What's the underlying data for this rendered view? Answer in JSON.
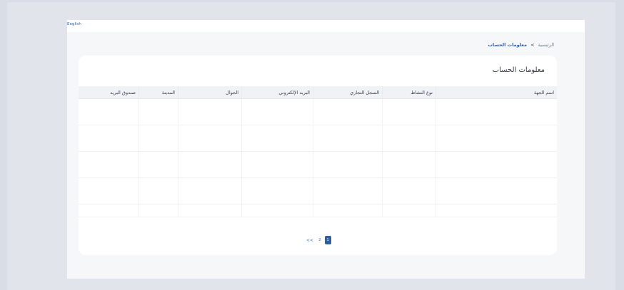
{
  "header": {
    "language_link": "English"
  },
  "breadcrumb": {
    "home": "الرئيسية",
    "separator": ">",
    "current": "معلومات الحساب"
  },
  "card": {
    "title": "معلومات الحساب"
  },
  "table": {
    "columns": [
      "اسم الجهة",
      "نوع النشاط",
      "السجل التجاري",
      "البريد الإلكتروني",
      "الجوال",
      "المدينة",
      "صندوق البريد"
    ],
    "rows": [
      [
        "",
        "",
        "",
        "",
        "",
        "",
        ""
      ],
      [
        "",
        "",
        "",
        "",
        "",
        "",
        ""
      ],
      [
        "",
        "",
        "",
        "",
        "",
        "",
        ""
      ],
      [
        "",
        "",
        "",
        "",
        "",
        "",
        ""
      ],
      [
        "",
        "",
        "",
        "",
        "",
        "",
        ""
      ]
    ]
  },
  "pagination": {
    "prev": "<<",
    "pages": [
      "2",
      "1"
    ],
    "active": "1"
  }
}
